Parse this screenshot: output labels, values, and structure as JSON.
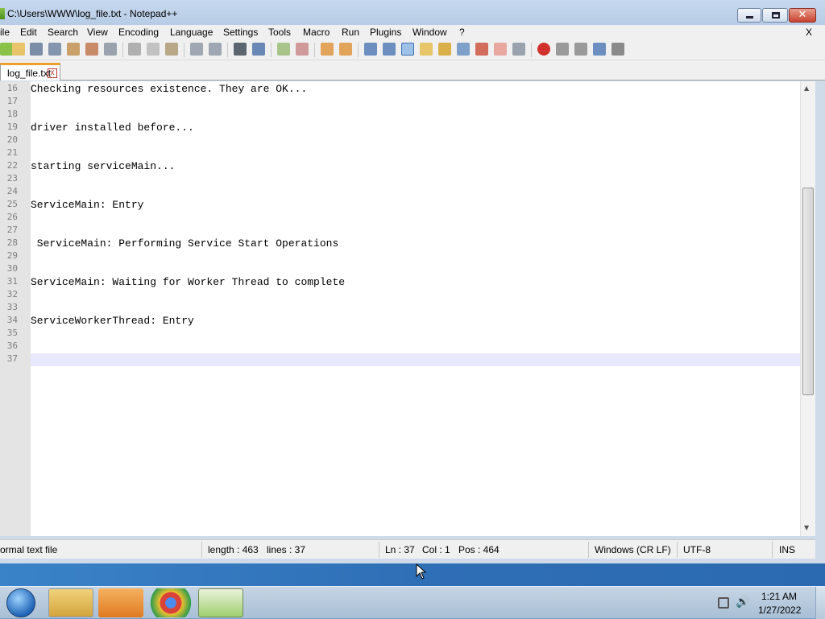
{
  "window": {
    "title": "C:\\Users\\WWW\\log_file.txt - Notepad++"
  },
  "menu": {
    "items": [
      "ile",
      "Edit",
      "Search",
      "View",
      "Encoding",
      "Language",
      "Settings",
      "Tools",
      "Macro",
      "Run",
      "Plugins",
      "Window",
      "?"
    ],
    "close": "X"
  },
  "tab": {
    "label": "log_file.txt",
    "close": "x"
  },
  "editor": {
    "lines": [
      {
        "n": "16",
        "text": "Checking resources existence. They are OK..."
      },
      {
        "n": "17",
        "text": ""
      },
      {
        "n": "18",
        "text": ""
      },
      {
        "n": "19",
        "text": "driver installed before..."
      },
      {
        "n": "20",
        "text": ""
      },
      {
        "n": "21",
        "text": ""
      },
      {
        "n": "22",
        "text": "starting serviceMain..."
      },
      {
        "n": "23",
        "text": ""
      },
      {
        "n": "24",
        "text": ""
      },
      {
        "n": "25",
        "text": "ServiceMain: Entry"
      },
      {
        "n": "26",
        "text": ""
      },
      {
        "n": "27",
        "text": ""
      },
      {
        "n": "28",
        "text": " ServiceMain: Performing Service Start Operations"
      },
      {
        "n": "29",
        "text": ""
      },
      {
        "n": "30",
        "text": ""
      },
      {
        "n": "31",
        "text": "ServiceMain: Waiting for Worker Thread to complete"
      },
      {
        "n": "32",
        "text": ""
      },
      {
        "n": "33",
        "text": ""
      },
      {
        "n": "34",
        "text": "ServiceWorkerThread: Entry"
      },
      {
        "n": "35",
        "text": ""
      },
      {
        "n": "36",
        "text": ""
      },
      {
        "n": "37",
        "text": ""
      }
    ]
  },
  "status": {
    "file_type": "ormal text file",
    "length": "length : 463",
    "lines": "lines : 37",
    "ln": "Ln : 37",
    "col": "Col : 1",
    "pos": "Pos : 464",
    "eol": "Windows (CR LF)",
    "encoding": "UTF-8",
    "mode": "INS"
  },
  "taskbar": {
    "time": "1:21 AM",
    "date": "1/27/2022"
  },
  "colors": {
    "current_line": "#e8e8ff",
    "gutter": "#e4e4e4",
    "tab_accent": "#f0a030"
  }
}
